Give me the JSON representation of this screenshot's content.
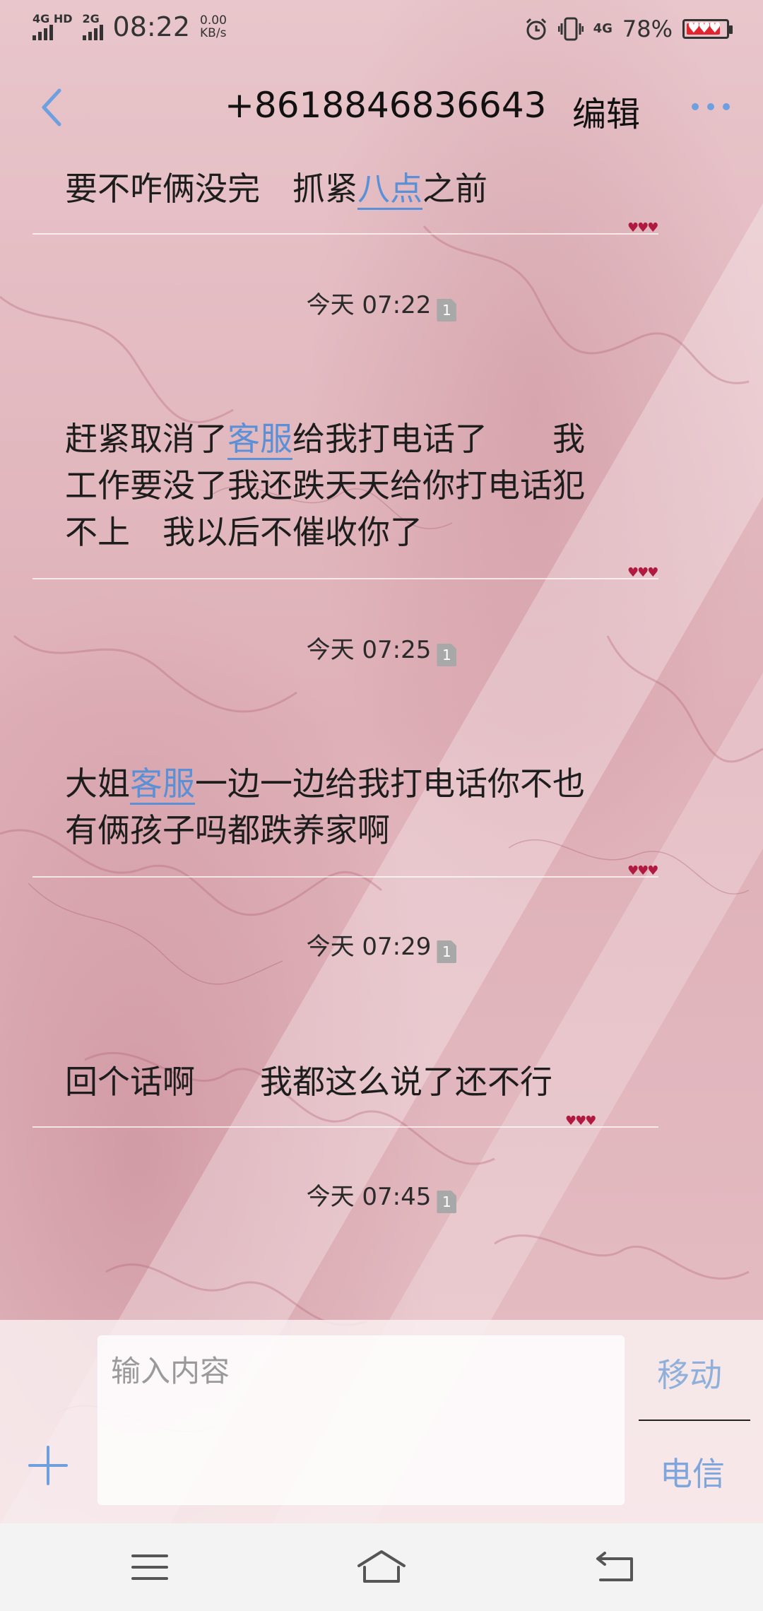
{
  "status_bar": {
    "network_1": "4G HD",
    "network_2": "2G",
    "time": "08:22",
    "speed_value": "0.00",
    "speed_unit": "KB/s",
    "network_3": "4G",
    "battery_percent": "78%",
    "icons": [
      "signal-icon",
      "alarm-icon",
      "vibrate-icon",
      "battery-icon"
    ]
  },
  "header": {
    "title": "+8618846836643",
    "edit_label": "编辑",
    "icons": [
      "back-icon",
      "more-icon"
    ]
  },
  "messages": [
    {
      "parts": [
        {
          "text": "要不咋俩没完　抓紧",
          "link": false
        },
        {
          "text": "八点",
          "link": true
        },
        {
          "text": "之前",
          "link": false
        }
      ]
    },
    {
      "timestamp": "今天 07:22",
      "sim": "1",
      "parts": [
        {
          "text": "赶紧取消了",
          "link": false
        },
        {
          "text": "客服",
          "link": true
        },
        {
          "text": "给我打电话了　　我工作要没了我还跌天天给你打电话犯不上　我以后不催收你了",
          "link": false
        }
      ]
    },
    {
      "timestamp": "今天 07:25",
      "sim": "1",
      "parts": [
        {
          "text": "大姐",
          "link": false
        },
        {
          "text": "客服",
          "link": true
        },
        {
          "text": "一边一边给我打电话你不也有俩孩子吗都跌养家啊",
          "link": false
        }
      ]
    },
    {
      "timestamp": "今天 07:29",
      "sim": "1",
      "parts": [
        {
          "text": "回个话啊　　我都这么说了还不行",
          "link": false
        }
      ]
    },
    {
      "timestamp": "今天 07:45",
      "sim": "1",
      "parts": []
    }
  ],
  "compose": {
    "placeholder": "输入内容",
    "send_sim1_label": "移动",
    "send_sim2_label": "电信",
    "icons": [
      "add-icon"
    ]
  },
  "navbar": {
    "icons": [
      "menu-icon",
      "home-icon",
      "back-nav-icon"
    ]
  },
  "colors": {
    "link": "#5b8fd6",
    "hearts": "#b01940",
    "send_label": "#7fa6dc"
  }
}
